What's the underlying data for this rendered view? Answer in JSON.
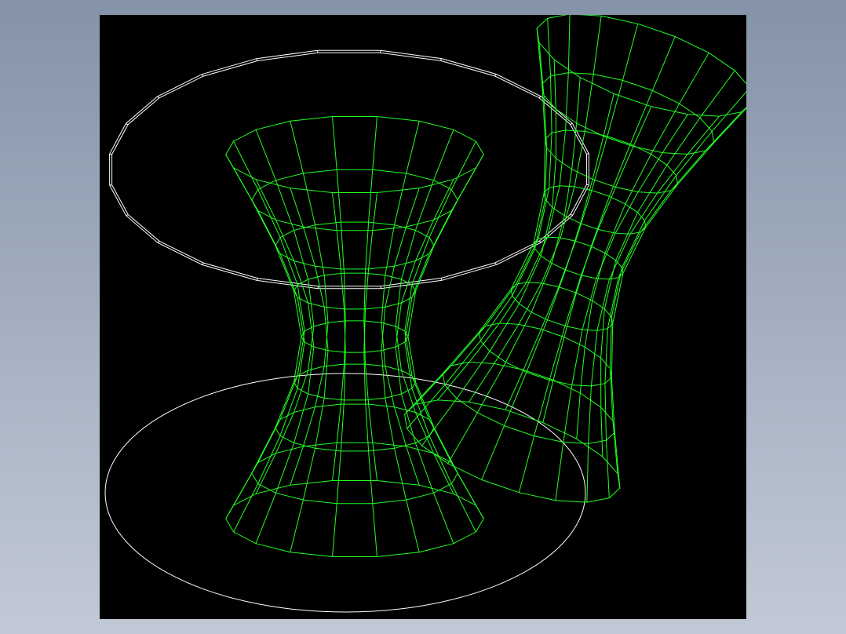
{
  "window": {
    "background_top": "#8593a8",
    "background_bottom": "#c2c9d6"
  },
  "viewport": {
    "background": "#000000"
  },
  "colors": {
    "wire_green": "#22ff22",
    "wire_white": "#ffffff"
  },
  "scene": {
    "objects": [
      {
        "name": "hyperboloid-vertical",
        "type": "hyperboloid-of-one-sheet",
        "color": "#22ff22",
        "segments": 18,
        "rings": 9
      },
      {
        "name": "hyperboloid-tilted",
        "type": "hyperboloid-of-one-sheet",
        "color": "#22ff22",
        "segments": 18,
        "rings": 9
      },
      {
        "name": "ring-top",
        "type": "segmented-disk",
        "color": "#ffffff",
        "segments": 24
      },
      {
        "name": "ellipse-bottom",
        "type": "ellipse",
        "color": "#ffffff"
      }
    ]
  }
}
